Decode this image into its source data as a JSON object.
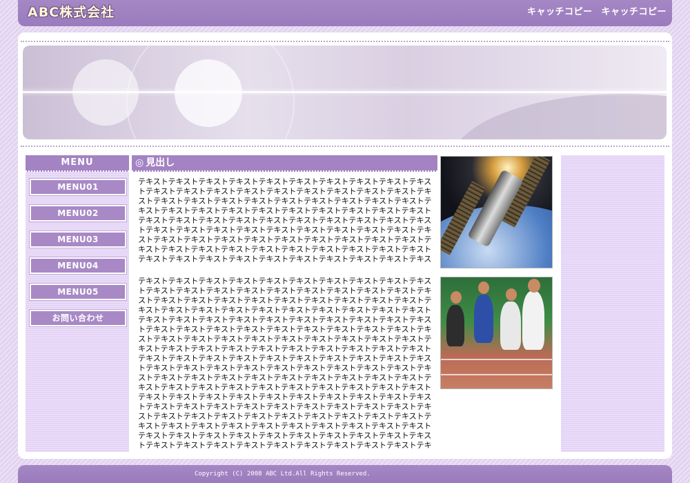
{
  "header": {
    "logo": "ABC株式会社",
    "catch_copy": [
      "キャッチコピー",
      "キャッチコピー"
    ]
  },
  "menu": {
    "title": "MENU",
    "items": [
      {
        "label": "MENU01"
      },
      {
        "label": "MENU02"
      },
      {
        "label": "MENU03"
      },
      {
        "label": "MENU04"
      },
      {
        "label": "MENU05"
      },
      {
        "label": "お問い合わせ"
      }
    ]
  },
  "content": {
    "heading": "見出し",
    "heading_mark": "◎",
    "para1": "テキストテキストテキストテキストテキストテキストテキストテキストテキストテキストテキストテキストテキストテキストテキストテキストテキストテキストテキストテキストテキストテキストテキストテキストテキストテキストテキストテキストテキストテキストテキストテキストテキストテキストテキストテキストテキストテキストテキストテキストテキストテキストテキストテキストテキストテキストテキストテキストテキストテキストテキストテキストテキストテキストテキストテキストテキストテキストテキストテキストテキストテキストテキストテキストテキストテキストテキストテキストテキストテキストテキストテキストテキストテキストテキストテキストテキストテキストテキストテキストテキストテキストテキストテキストテキストテキストテキストテキストテキスト",
    "para2": "テキストテキストテキストテキストテキストテキストテキストテキストテキストテキストテキストテキストテキストテキストテキストテキストテキストテキストテキストテキストテキストテキストテキストテキストテキストテキストテキストテキストテキストテキストテキストテキストテキストテキストテキストテキストテキストテキストテキストテキストテキストテキストテキストテキストテキストテキストテキストテキストテキストテキストテキストテキストテキストテキストテキストテキストテキストテキストテキストテキストテキストテキストテキストテキストテキストテキストテキストテキストテキストテキストテキストテキストテキストテキストテキストテキストテキストテキストテキストテキストテキストテキストテキストテキストテキストテキストテキストテキストテキストテキストテキストテキストテキストテキストテキストテキストテキストテキストテキストテキストテキストテキストテキストテキストテキストテキストテキストテキストテキストテキストテキストテキストテキストテキストテキストテキストテキストテキストテキストテキストテキストテキストテキストテキストテキストテキストテキストテキストテキストテキストテキストテキストテキストテキストテキストテキストテキストテキストテキストテキストテキストテキストテキストテキストテキストテキストテキストテキストテキストテキストテキストテキストテキストテキストテキストテキストテキストテキストテキストテキストテキストテキストテキストテキストテキストテキストテキストテキストテキストテキストテキストテキストテキストテキストテキストテキストテキストテキストテキストテキストテキストテキストテキストテキストテキストテキストテキストテキストテキストテキストテキストテキストテキストテキストテキストテキストテキストテキストテキストテキストテキストテキストテキストテキスト"
  },
  "footer": {
    "copyright": "Copyright (C) 2008 ABC Ltd.All Rights Reserved."
  },
  "colors": {
    "accent": "#a383c2",
    "side_panel": "#e4d3f6",
    "background": "#e2d3f0"
  }
}
